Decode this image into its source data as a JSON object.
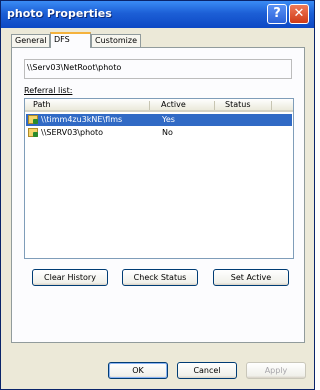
{
  "window": {
    "title": "photo Properties",
    "help_glyph": "?",
    "close_glyph": "✕"
  },
  "tabs": [
    {
      "label": "General"
    },
    {
      "label": "DFS"
    },
    {
      "label": "Customize"
    }
  ],
  "dfs": {
    "path": "\\\\Serv03\\NetRoot\\photo",
    "referral_label": "Referral list:",
    "columns": [
      "Path",
      "Active",
      "Status"
    ],
    "rows": [
      {
        "path": "\\\\timm4zu3kNE\\flms",
        "active": "Yes",
        "status": "",
        "selected": true
      },
      {
        "path": "\\\\SERV03\\photo",
        "active": "No",
        "status": "",
        "selected": false
      }
    ],
    "buttons": {
      "clear_history": "Clear History",
      "check_status": "Check Status",
      "set_active": "Set Active"
    }
  },
  "footer": {
    "ok": "OK",
    "cancel": "Cancel",
    "apply": "Apply"
  },
  "colors": {
    "titlebar": "#1c5fd6",
    "selection": "#316ac5",
    "tab_highlight": "#f5b23c",
    "face": "#ece9d8"
  }
}
